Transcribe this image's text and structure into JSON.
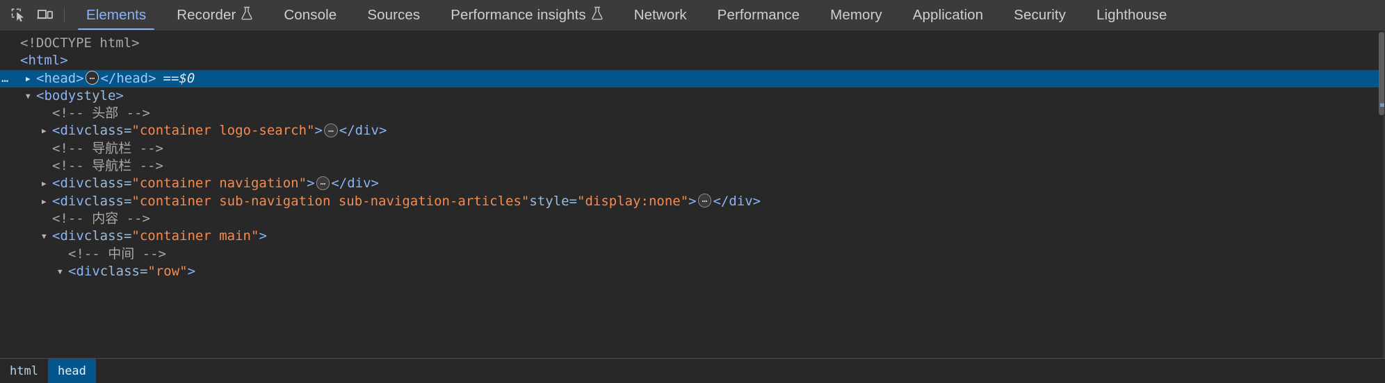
{
  "toolbar": {
    "inspect_icon": "inspect-element-icon",
    "device_icon": "device-toolbar-icon"
  },
  "tabs": [
    {
      "label": "Elements",
      "selected": true,
      "experiment": false
    },
    {
      "label": "Recorder",
      "selected": false,
      "experiment": true
    },
    {
      "label": "Console",
      "selected": false,
      "experiment": false
    },
    {
      "label": "Sources",
      "selected": false,
      "experiment": false
    },
    {
      "label": "Performance insights",
      "selected": false,
      "experiment": true
    },
    {
      "label": "Network",
      "selected": false,
      "experiment": false
    },
    {
      "label": "Performance",
      "selected": false,
      "experiment": false
    },
    {
      "label": "Memory",
      "selected": false,
      "experiment": false
    },
    {
      "label": "Application",
      "selected": false,
      "experiment": false
    },
    {
      "label": "Security",
      "selected": false,
      "experiment": false
    },
    {
      "label": "Lighthouse",
      "selected": false,
      "experiment": false
    }
  ],
  "dom_tree": [
    {
      "id": "doctype",
      "indent": 0,
      "twisty": "none",
      "selected": false,
      "gutter": "",
      "parts": [
        {
          "cls": "doctype",
          "text": "<!DOCTYPE html>"
        }
      ]
    },
    {
      "id": "html-open",
      "indent": 0,
      "twisty": "none",
      "selected": false,
      "gutter": "",
      "parts": [
        {
          "cls": "tag",
          "text": "<html>"
        }
      ]
    },
    {
      "id": "head",
      "indent": 1,
      "twisty": "closed",
      "selected": true,
      "gutter": "…",
      "parts": [
        {
          "cls": "tag",
          "text": "<head>"
        },
        {
          "cls": "badge",
          "text": "…"
        },
        {
          "cls": "tag",
          "text": "</head>"
        },
        {
          "cls": "eq-sel",
          "text": "=="
        },
        {
          "cls": "dollar",
          "text": " $0"
        }
      ]
    },
    {
      "id": "body",
      "indent": 1,
      "twisty": "open",
      "selected": false,
      "gutter": "",
      "parts": [
        {
          "cls": "tag",
          "text": "<body"
        },
        {
          "cls": "attr",
          "text": " style"
        },
        {
          "cls": "tag",
          "text": ">"
        }
      ]
    },
    {
      "id": "comment-header",
      "indent": 2,
      "twisty": "none",
      "selected": false,
      "gutter": "",
      "parts": [
        {
          "cls": "comment",
          "text": "<!--  头部  -->"
        }
      ]
    },
    {
      "id": "div-logo-search",
      "indent": 2,
      "twisty": "closed",
      "selected": false,
      "gutter": "",
      "parts": [
        {
          "cls": "tag",
          "text": "<div "
        },
        {
          "cls": "attr",
          "text": "class="
        },
        {
          "cls": "val",
          "text": "\"container logo-search\""
        },
        {
          "cls": "tag",
          "text": ">"
        },
        {
          "cls": "badge",
          "text": "…"
        },
        {
          "cls": "tag",
          "text": "</div>"
        }
      ]
    },
    {
      "id": "comment-nav-1",
      "indent": 2,
      "twisty": "none",
      "selected": false,
      "gutter": "",
      "parts": [
        {
          "cls": "comment",
          "text": "<!-- 导航栏 -->"
        }
      ]
    },
    {
      "id": "comment-nav-2",
      "indent": 2,
      "twisty": "none",
      "selected": false,
      "gutter": "",
      "parts": [
        {
          "cls": "comment",
          "text": "<!-- 导航栏 -->"
        }
      ]
    },
    {
      "id": "div-navigation",
      "indent": 2,
      "twisty": "closed",
      "selected": false,
      "gutter": "",
      "parts": [
        {
          "cls": "tag",
          "text": "<div "
        },
        {
          "cls": "attr",
          "text": "class="
        },
        {
          "cls": "val",
          "text": "\"container navigation\""
        },
        {
          "cls": "tag",
          "text": ">"
        },
        {
          "cls": "badge",
          "text": "…"
        },
        {
          "cls": "tag",
          "text": "</div>"
        }
      ]
    },
    {
      "id": "div-sub-navigation",
      "indent": 2,
      "twisty": "closed",
      "selected": false,
      "gutter": "",
      "parts": [
        {
          "cls": "tag",
          "text": "<div "
        },
        {
          "cls": "attr",
          "text": "class="
        },
        {
          "cls": "val",
          "text": "\"container sub-navigation sub-navigation-articles\""
        },
        {
          "cls": "attr",
          "text": " style="
        },
        {
          "cls": "val",
          "text": "\"display:none\""
        },
        {
          "cls": "tag",
          "text": ">"
        },
        {
          "cls": "badge",
          "text": "…"
        },
        {
          "cls": "tag",
          "text": "</div>"
        }
      ]
    },
    {
      "id": "comment-content",
      "indent": 2,
      "twisty": "none",
      "selected": false,
      "gutter": "",
      "parts": [
        {
          "cls": "comment",
          "text": "<!--  内容  -->"
        }
      ]
    },
    {
      "id": "div-main",
      "indent": 2,
      "twisty": "open",
      "selected": false,
      "gutter": "",
      "parts": [
        {
          "cls": "tag",
          "text": "<div "
        },
        {
          "cls": "attr",
          "text": "class="
        },
        {
          "cls": "val",
          "text": "\"container main\""
        },
        {
          "cls": "tag",
          "text": ">"
        }
      ]
    },
    {
      "id": "comment-middle",
      "indent": 3,
      "twisty": "none",
      "selected": false,
      "gutter": "",
      "parts": [
        {
          "cls": "comment",
          "text": "<!-- 中间 -->"
        }
      ]
    },
    {
      "id": "div-row",
      "indent": 3,
      "twisty": "open",
      "selected": false,
      "gutter": "",
      "parts": [
        {
          "cls": "tag",
          "text": "<div "
        },
        {
          "cls": "attr",
          "text": "class="
        },
        {
          "cls": "val",
          "text": "\"row\""
        },
        {
          "cls": "tag",
          "text": ">"
        }
      ]
    }
  ],
  "breadcrumb": [
    {
      "label": "html",
      "selected": false
    },
    {
      "label": "head",
      "selected": true
    }
  ],
  "colors": {
    "accent": "#8ab4f8",
    "selection": "#04568a",
    "toolbar_bg": "#3b3b3b",
    "panel_bg": "#282828",
    "tag": "#8ab4f8",
    "attr_value": "#f28b54",
    "comment": "#a8a8a8"
  }
}
